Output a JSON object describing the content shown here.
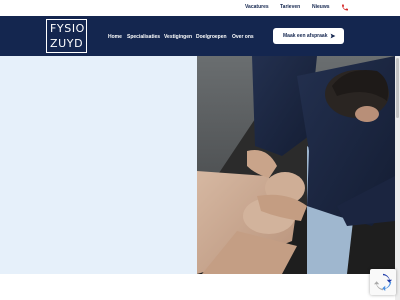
{
  "topbar": {
    "links": [
      "Vacatures",
      "Tarieven",
      "Nieuws"
    ],
    "phone_icon": "phone-icon"
  },
  "header": {
    "logo": {
      "line1": "FYSIO",
      "line2": "ZUYD"
    },
    "menu": [
      "Home",
      "Specialisaties",
      "Vestigingen",
      "Doelgroepen",
      "Over ons"
    ],
    "cta_label": "Maak een afspraak",
    "cta_icon": "send-arrow-icon"
  },
  "colors": {
    "brand_navy": "#14264f",
    "hero_panel": "#e6f0fa",
    "phone_accent": "#d62b2b"
  },
  "hero": {
    "image": "physiotherapist-treating-knee-photo"
  },
  "widgets": {
    "recaptcha_icon": "recaptcha-icon"
  }
}
